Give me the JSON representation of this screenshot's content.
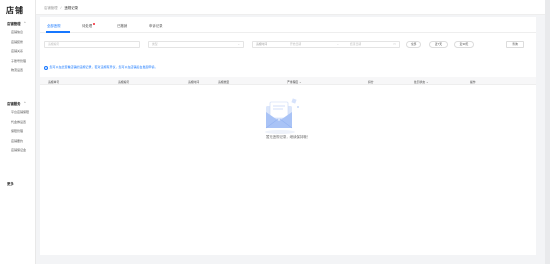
{
  "sidebar": {
    "logo": "店铺",
    "groups": [
      {
        "title": "店铺管理",
        "items": [
          "店铺信息",
          "店铺装修",
          "店铺关系",
          "子账号管理",
          "物流设置"
        ]
      },
      {
        "title": "店铺服务",
        "items": [
          "平台店铺保障",
          "代金券设置",
          "保障管理",
          "店铺要约",
          "店铺保证金"
        ]
      },
      {
        "title": "更多",
        "items": []
      }
    ]
  },
  "breadcrumb": {
    "parent": "店铺管理",
    "separator": "/",
    "current": "违规记录"
  },
  "tabs": [
    {
      "label": "全部违规",
      "active": true
    },
    {
      "label": "待处理",
      "badge": true
    },
    {
      "label": "已撤销"
    },
    {
      "label": "申诉记录"
    }
  ],
  "filters": {
    "keyword_placeholder": "违规编号",
    "type_placeholder": "类型",
    "date_label": "违规时间",
    "date_start_placeholder": "开始日期",
    "date_separator": "~",
    "date_end_placeholder": "结束日期",
    "btn_all": "全部",
    "btn_week": "近7天",
    "btn_month": "近30天",
    "btn_query": "查询"
  },
  "info": {
    "icon": "info-icon",
    "text": "您可以在此查看店铺的违规记录，若对违规有异议，您可以在店铺后台发起申诉。"
  },
  "table": {
    "columns": [
      "违规单号",
      "违规编号",
      "违规时间",
      "违规类型",
      "严重程度",
      "扣分",
      "处罚状态",
      "操作"
    ],
    "rows": []
  },
  "empty": {
    "icon": "empty-mail-icon",
    "text": "暂无违规记录，继续保持哦！"
  },
  "colors": {
    "accent": "#1677ff",
    "badge": "#f5222d"
  }
}
